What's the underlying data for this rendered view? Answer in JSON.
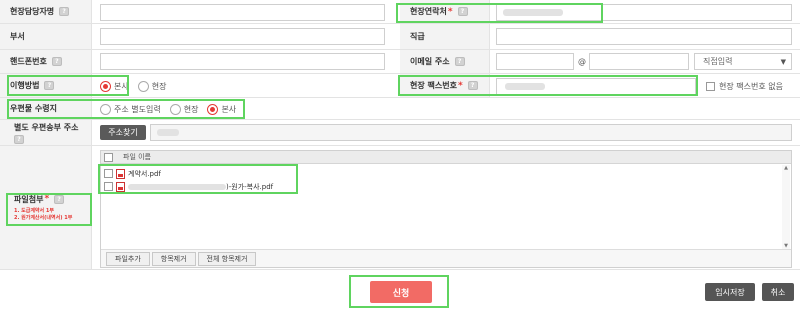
{
  "form": {
    "site_manager_label": "현장담당자명",
    "site_contact_label": "현장연락처",
    "department_label": "부서",
    "position_label": "직급",
    "mobile_label": "핸드폰번호",
    "email_label": "이메일 주소",
    "email_at": "@",
    "email_domain_select": "직접입력",
    "fulfillment_label": "이행방법",
    "fulfillment_options": [
      "본사",
      "현장"
    ],
    "fulfillment_selected": "본사",
    "site_fax_label": "현장 팩스번호",
    "no_fax_label": "현장 팩스번호 없음",
    "mail_receive_label": "우편물 수령지",
    "mail_receive_options": [
      "주소 별도입력",
      "현장",
      "본사"
    ],
    "mail_receive_selected": "본사",
    "separate_address_label": "별도 우편송부 주소",
    "address_search_button": "주소찾기",
    "attachment_label": "파일첨부",
    "attachment_notes": [
      "1. 도급계약서 1부",
      "2. 원가계산서(내역서) 1부"
    ],
    "file_column_header": "파일 이름",
    "files": [
      {
        "name": "계약서.pdf"
      },
      {
        "name": ")-원가-복사.pdf"
      }
    ],
    "file_buttons": [
      "파일추가",
      "항목제거",
      "전체 항목제거"
    ],
    "required_mark": "*",
    "help_icon_glyph": "?"
  },
  "actions": {
    "apply": "신청",
    "temp_save": "임시저장",
    "cancel": "취소"
  },
  "colors": {
    "highlight": "#5fd45f",
    "apply_button": "#f26b65",
    "required": "#e53935",
    "label_bg": "#f3f3f3"
  }
}
